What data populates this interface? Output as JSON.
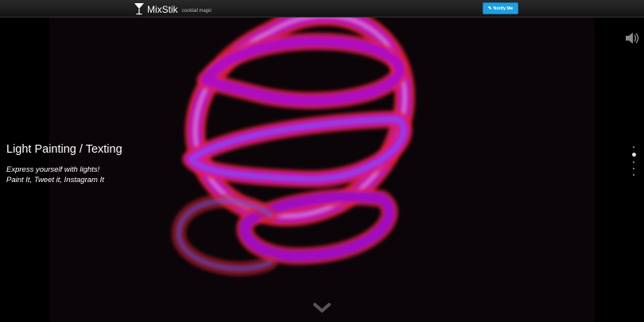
{
  "header": {
    "brand_name": "MixStik",
    "brand_tagline": "cocktail magic",
    "notify_label": "Notify Me"
  },
  "hero": {
    "title": "Light Painting / Texting",
    "line1": "Express yourself with lights!",
    "line2": "Paint It, Tweet it, Instagram It"
  },
  "pagination": {
    "total": 4,
    "active_index": 0
  },
  "icons": {
    "logo": "cocktail-glass-icon",
    "notify": "pencil-icon",
    "sound": "speaker-icon",
    "scroll": "chevron-down-icon"
  },
  "colors": {
    "accent": "#1f9fe0",
    "ribbon_magenta": "#c018c8",
    "ribbon_red": "#e02030",
    "ribbon_blue": "#4060ff"
  }
}
